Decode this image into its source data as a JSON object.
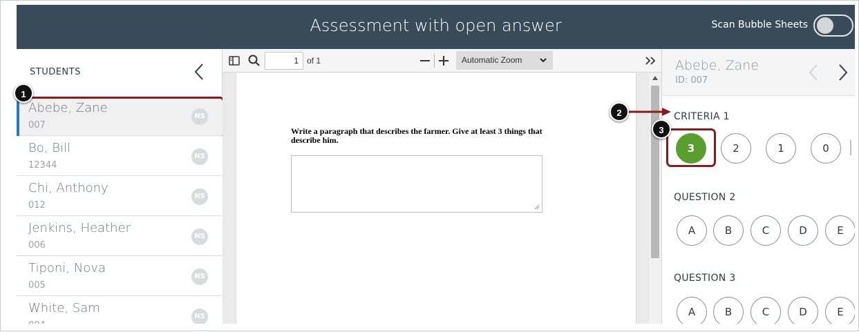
{
  "header": {
    "title": "Assessment with open answer",
    "scan_label": "Scan Bubble Sheets",
    "scan_enabled": false
  },
  "students": {
    "heading": "STUDENTS",
    "items": [
      {
        "name": "Abebe, Zane",
        "id": "007",
        "status": "NS",
        "active": true
      },
      {
        "name": "Bo, Bill",
        "id": "12344",
        "status": "NS",
        "active": false
      },
      {
        "name": "Chi, Anthony",
        "id": "012",
        "status": "NS",
        "active": false
      },
      {
        "name": "Jenkins, Heather",
        "id": "006",
        "status": "NS",
        "active": false
      },
      {
        "name": "Tiponi, Nova",
        "id": "005",
        "status": "NS",
        "active": false
      },
      {
        "name": "White, Sam",
        "id": "004",
        "status": "NS",
        "active": false
      }
    ]
  },
  "viewer": {
    "page_value": "1",
    "page_total": "of 1",
    "zoom": "Automatic Zoom",
    "prompt": "Write a paragraph that describes the farmer. Give at least 3 things that describe him."
  },
  "grading": {
    "student_name": "Abebe, Zane",
    "student_id": "ID: 007",
    "criteria_label": "CRITERIA 1",
    "criteria_options": [
      "3",
      "2",
      "1",
      "0"
    ],
    "criteria_selected": "3",
    "question2_label": "QUESTION 2",
    "question2_options": [
      "A",
      "B",
      "C",
      "D",
      "E"
    ],
    "question3_label": "QUESTION 3",
    "question3_options": [
      "A",
      "B",
      "C",
      "D",
      "E"
    ]
  },
  "callouts": [
    "1",
    "2",
    "3"
  ],
  "colors": {
    "header_bg": "#394b58",
    "selected_green": "#5a9e2f",
    "callout_red": "#8b1a1a",
    "active_accent": "#2a7ab8"
  }
}
